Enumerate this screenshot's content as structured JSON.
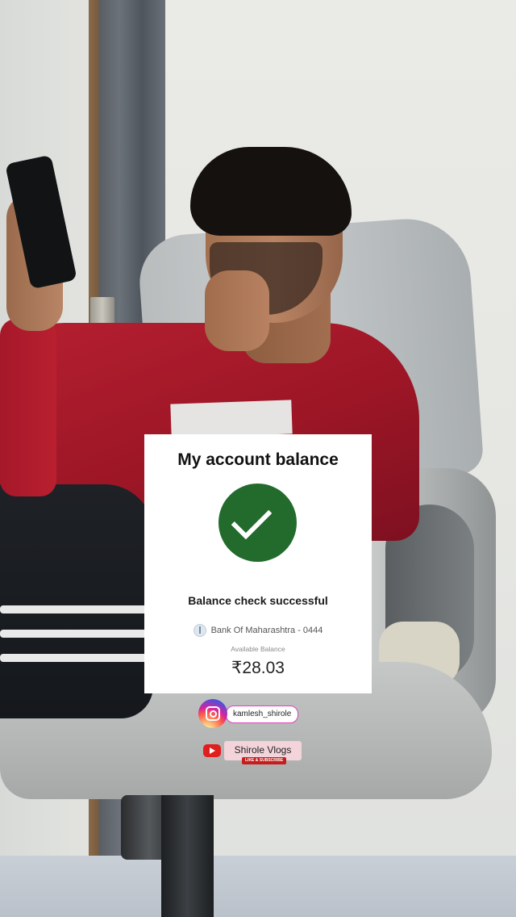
{
  "card": {
    "title": "My account balance",
    "status": "Balance check successful",
    "bank_name": "Bank Of Maharashtra - 0444",
    "available_label": "Available Balance",
    "amount": "₹28.03",
    "check_color": "#236b2d"
  },
  "social": {
    "instagram_handle": "kamlesh_shirole",
    "youtube_channel": "Shirole Vlogs",
    "youtube_badge": "LIKE & SUBSCRIBE"
  },
  "icons": {
    "success": "check-circle-icon",
    "bank": "bank-logo-icon",
    "instagram": "instagram-icon",
    "youtube": "youtube-icon"
  }
}
